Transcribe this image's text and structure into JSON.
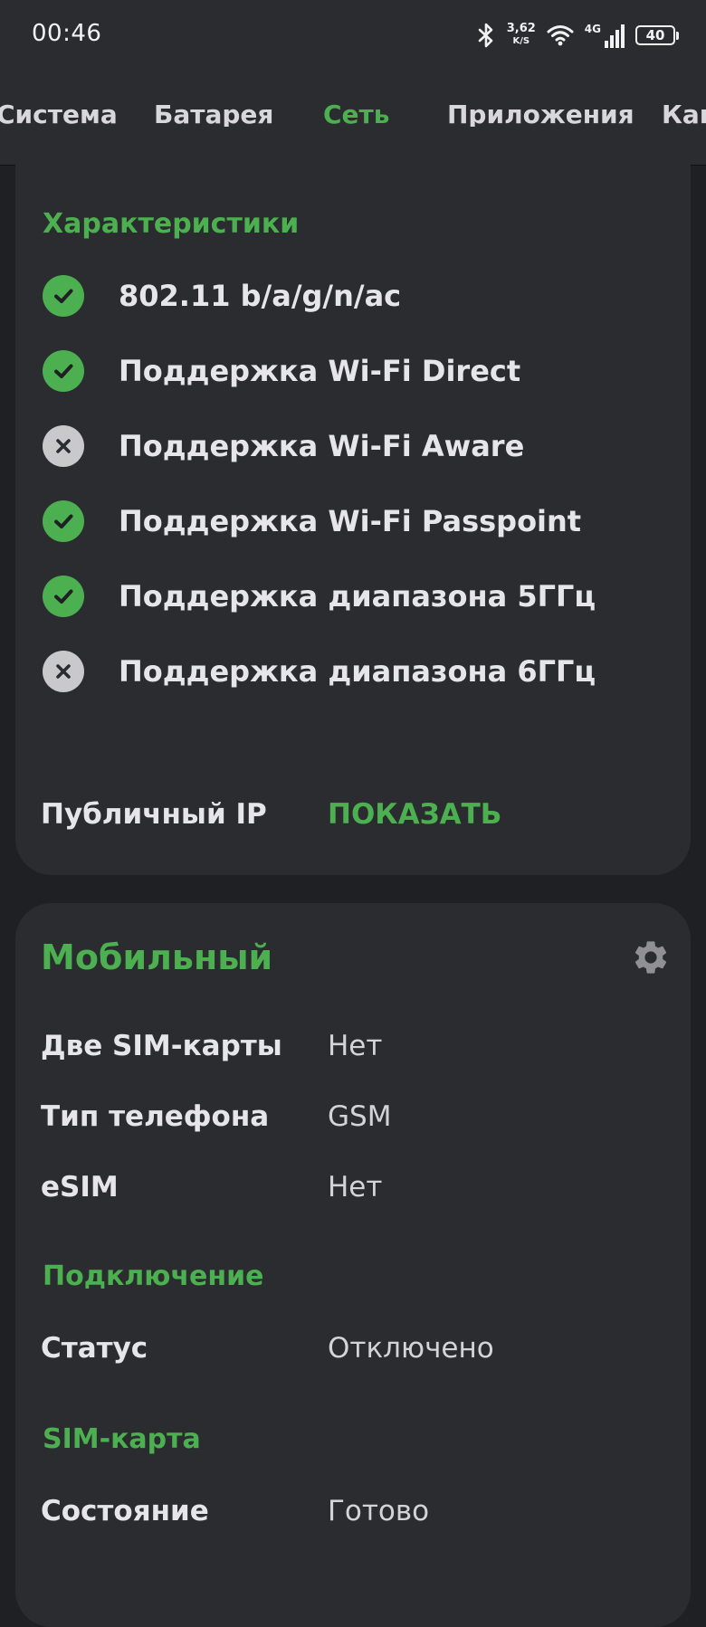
{
  "status_bar": {
    "time": "00:46",
    "net_speed_value": "3,62",
    "net_speed_unit": "K/S",
    "network_type": "4G",
    "battery": "40"
  },
  "tabs": [
    {
      "label": "Система"
    },
    {
      "label": "Батарея"
    },
    {
      "label": "Сеть"
    },
    {
      "label": "Приложения"
    },
    {
      "label": "Кам"
    }
  ],
  "active_tab": "Сеть",
  "wifi_card": {
    "features_title": "Характеристики",
    "features": [
      {
        "label": "802.11 b/a/g/n/ac",
        "supported": true
      },
      {
        "label": "Поддержка Wi-Fi Direct",
        "supported": true
      },
      {
        "label": "Поддержка Wi-Fi Aware",
        "supported": false
      },
      {
        "label": "Поддержка Wi-Fi Passpoint",
        "supported": true
      },
      {
        "label": "Поддержка диапазона 5ГГц",
        "supported": true
      },
      {
        "label": "Поддержка диапазона 6ГГц",
        "supported": false
      }
    ],
    "public_ip_label": "Публичный IP",
    "public_ip_action": "ПОКАЗАТЬ"
  },
  "mobile_card": {
    "title": "Мобильный",
    "rows": [
      {
        "label": "Две SIM-карты",
        "value": "Нет"
      },
      {
        "label": "Тип телефона",
        "value": "GSM"
      },
      {
        "label": "eSIM",
        "value": "Нет"
      }
    ],
    "connection_title": "Подключение",
    "connection_rows": [
      {
        "label": "Статус",
        "value": "Отключено"
      }
    ],
    "sim_title": "SIM-карта",
    "sim_rows": [
      {
        "label": "Состояние",
        "value": "Готово"
      }
    ]
  },
  "colors": {
    "accent": "#4caf50",
    "card": "#2b2c30",
    "background": "#1f2023"
  }
}
